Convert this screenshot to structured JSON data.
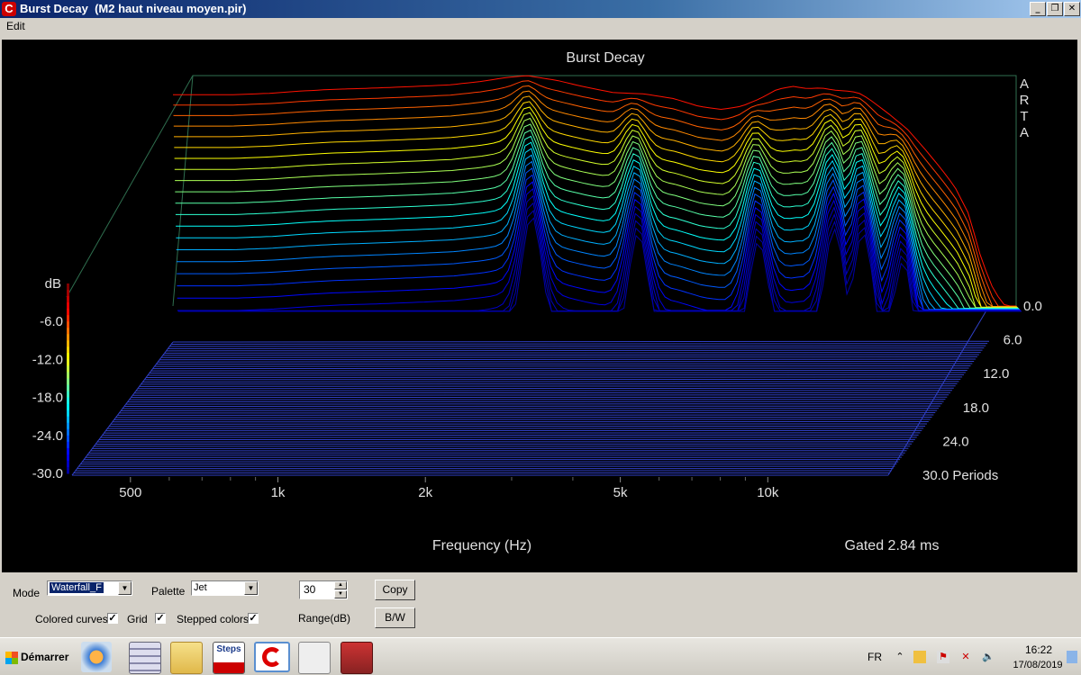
{
  "window": {
    "title": "Burst Decay  (M2 haut niveau moyen.pir)",
    "menu": [
      "Edit"
    ]
  },
  "chart_data": {
    "type": "waterfall",
    "title": "Burst Decay",
    "xlabel": "Frequency (Hz)",
    "x_scale": "log",
    "x_ticks": [
      "500",
      "1k",
      "2k",
      "5k",
      "10k"
    ],
    "x_tick_values": [
      500,
      1000,
      2000,
      5000,
      10000
    ],
    "xlim": [
      380,
      20000
    ],
    "ylabel": "dB",
    "y_ticks": [
      "-6.0",
      "-12.0",
      "-18.0",
      "-24.0",
      "-30.0"
    ],
    "y_tick_values": [
      -6,
      -12,
      -18,
      -24,
      -30
    ],
    "ylim": [
      -30,
      0
    ],
    "z_label": "Periods",
    "z_ticks": [
      "0.0",
      "6.0",
      "12.0",
      "18.0",
      "24.0",
      "30.0"
    ],
    "z_tick_values": [
      0,
      6,
      12,
      18,
      24,
      30
    ],
    "zlim": [
      0,
      30
    ],
    "watermark": "ARTA",
    "gate_note": "Gated 2.84 ms",
    "palette": "Jet",
    "grid": true,
    "num_slices": 60,
    "first_slice_response": {
      "freq_hz": [
        500,
        600,
        700,
        800,
        900,
        1000,
        1200,
        1400,
        1600,
        1800,
        2000,
        2300,
        2600,
        3000,
        3500,
        4000,
        4500,
        5000,
        5500,
        6000,
        6500,
        7000,
        7500,
        8000,
        8500,
        9000,
        9500,
        10000,
        11000,
        12000,
        13000,
        14000,
        15000,
        16000,
        17000,
        18000,
        19000
      ],
      "db": [
        -2.5,
        -2.3,
        -2.0,
        -1.8,
        -1.7,
        -1.6,
        -1.4,
        -1.2,
        -0.8,
        -0.3,
        0.0,
        -0.6,
        -1.4,
        -2.2,
        -2.4,
        -3.0,
        -4.0,
        -4.4,
        -4.0,
        -3.0,
        -1.8,
        -1.4,
        -1.7,
        -1.6,
        -1.9,
        -2.0,
        -2.2,
        -3.0,
        -5.0,
        -7.0,
        -9.5,
        -12.0,
        -14.5,
        -18.0,
        -24.0,
        -28.0,
        -30.0
      ]
    },
    "decay_notes": "Later slices decay towards the -30 dB floor; strongest ringing persists near 2k, 3.3k, 5.8k, 8.3k, 9.5k, 11.5k Hz."
  },
  "controls": {
    "mode_label": "Mode",
    "mode_value": "Waterfall_F",
    "palette_label": "Palette",
    "palette_value": "Jet",
    "range_value": "30",
    "range_label": "Range(dB)",
    "copy_label": "Copy",
    "bw_label": "B/W",
    "colored_curves_label": "Colored curves",
    "colored_curves_checked": true,
    "grid_label": "Grid",
    "grid_checked": true,
    "stepped_colors_label": "Stepped colors",
    "stepped_colors_checked": true
  },
  "taskbar": {
    "start_label": "Démarrer",
    "apps": [
      "media-player-icon",
      "calculator-icon",
      "folder-icon",
      "steps-icon",
      "arta-icon",
      "limp-icon",
      "stereo-icon"
    ],
    "steps_text": "Steps",
    "lang": "FR",
    "time": "16:22",
    "date": "17/08/2019"
  }
}
